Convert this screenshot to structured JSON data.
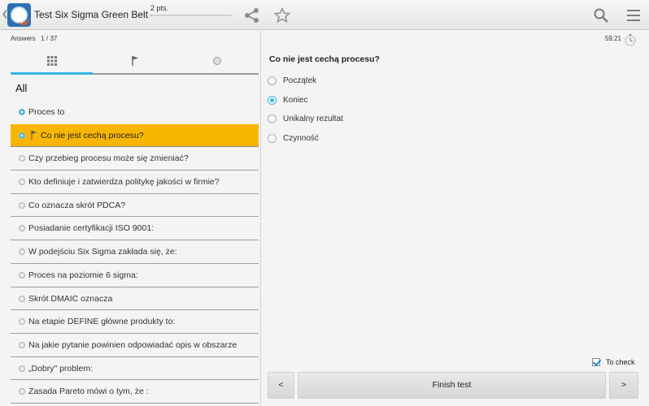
{
  "header": {
    "title": "Test Six Sigma Green Belt",
    "points_label": "2 pts.",
    "progress_fraction": 0.01,
    "icons": [
      "back-chevron-icon",
      "app-logo",
      "share-icon",
      "star-icon",
      "search-icon",
      "menu-icon"
    ]
  },
  "left": {
    "answers_label": "Answers",
    "answers_count": "1 / 37",
    "tabs": [
      {
        "name": "grid-icon",
        "active": true
      },
      {
        "name": "flag-icon",
        "active": false
      },
      {
        "name": "circle-icon",
        "active": false
      }
    ],
    "list_heading": "All",
    "questions": [
      {
        "text": "Proces to",
        "answered": true,
        "active": false,
        "flagged": false
      },
      {
        "text": "Co nie jest cechą procesu?",
        "answered": true,
        "active": true,
        "flagged": true
      },
      {
        "text": "Czy przebieg procesu może się zmieniać?",
        "answered": false,
        "active": false,
        "flagged": false
      },
      {
        "text": "Kto definiuje i zatwierdza politykę jakości w firmie?",
        "answered": false,
        "active": false,
        "flagged": false
      },
      {
        "text": "Co oznacza skrót PDCA?",
        "answered": false,
        "active": false,
        "flagged": false
      },
      {
        "text": "Posiadanie certyfikacji ISO 9001:",
        "answered": false,
        "active": false,
        "flagged": false
      },
      {
        "text": "W podejściu Six Sigma zakłada się, że:",
        "answered": false,
        "active": false,
        "flagged": false
      },
      {
        "text": "Proces na poziomie 6 sigma:",
        "answered": false,
        "active": false,
        "flagged": false
      },
      {
        "text": "Skrót DMAIC oznacza",
        "answered": false,
        "active": false,
        "flagged": false
      },
      {
        "text": "Na etapie DEFINE główne produkty to:",
        "answered": false,
        "active": false,
        "flagged": false
      },
      {
        "text": "Na jakie pytanie powinien odpowiadać opis w obszarze",
        "answered": false,
        "active": false,
        "flagged": false
      },
      {
        "text": "„Dobry\" problem:",
        "answered": false,
        "active": false,
        "flagged": false
      },
      {
        "text": "Zasada Pareto mówi o tym, że :",
        "answered": false,
        "active": false,
        "flagged": false
      }
    ]
  },
  "right": {
    "timer": "59:21",
    "question": "Co nie jest cechą procesu?",
    "options": [
      {
        "text": "Początek",
        "selected": false
      },
      {
        "text": "Koniec",
        "selected": true
      },
      {
        "text": "Unikalny rezultat",
        "selected": false
      },
      {
        "text": "Czynność",
        "selected": false
      }
    ],
    "to_check_label": "To check",
    "to_check_checked": true,
    "prev_label": "<",
    "finish_label": "Finish test",
    "next_label": ">"
  },
  "colors": {
    "accent": "#33b5e5",
    "active_row": "#f8b600",
    "logo_blue": "#2d6fb5",
    "logo_orange": "#e05a1f"
  }
}
